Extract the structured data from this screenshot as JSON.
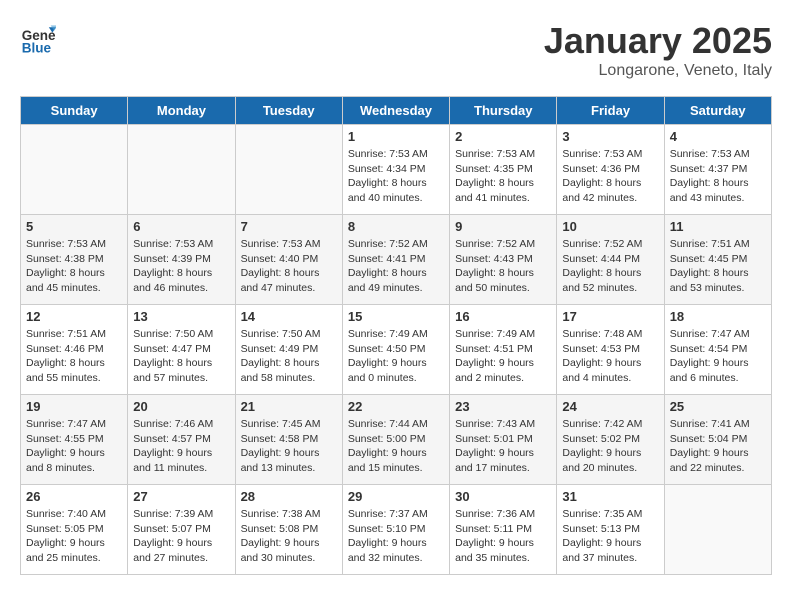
{
  "header": {
    "logo_general": "General",
    "logo_blue": "Blue",
    "month": "January 2025",
    "location": "Longarone, Veneto, Italy"
  },
  "weekdays": [
    "Sunday",
    "Monday",
    "Tuesday",
    "Wednesday",
    "Thursday",
    "Friday",
    "Saturday"
  ],
  "weeks": [
    [
      {
        "day": "",
        "sunrise": "",
        "sunset": "",
        "daylight": ""
      },
      {
        "day": "",
        "sunrise": "",
        "sunset": "",
        "daylight": ""
      },
      {
        "day": "",
        "sunrise": "",
        "sunset": "",
        "daylight": ""
      },
      {
        "day": "1",
        "sunrise": "Sunrise: 7:53 AM",
        "sunset": "Sunset: 4:34 PM",
        "daylight": "Daylight: 8 hours and 40 minutes."
      },
      {
        "day": "2",
        "sunrise": "Sunrise: 7:53 AM",
        "sunset": "Sunset: 4:35 PM",
        "daylight": "Daylight: 8 hours and 41 minutes."
      },
      {
        "day": "3",
        "sunrise": "Sunrise: 7:53 AM",
        "sunset": "Sunset: 4:36 PM",
        "daylight": "Daylight: 8 hours and 42 minutes."
      },
      {
        "day": "4",
        "sunrise": "Sunrise: 7:53 AM",
        "sunset": "Sunset: 4:37 PM",
        "daylight": "Daylight: 8 hours and 43 minutes."
      }
    ],
    [
      {
        "day": "5",
        "sunrise": "Sunrise: 7:53 AM",
        "sunset": "Sunset: 4:38 PM",
        "daylight": "Daylight: 8 hours and 45 minutes."
      },
      {
        "day": "6",
        "sunrise": "Sunrise: 7:53 AM",
        "sunset": "Sunset: 4:39 PM",
        "daylight": "Daylight: 8 hours and 46 minutes."
      },
      {
        "day": "7",
        "sunrise": "Sunrise: 7:53 AM",
        "sunset": "Sunset: 4:40 PM",
        "daylight": "Daylight: 8 hours and 47 minutes."
      },
      {
        "day": "8",
        "sunrise": "Sunrise: 7:52 AM",
        "sunset": "Sunset: 4:41 PM",
        "daylight": "Daylight: 8 hours and 49 minutes."
      },
      {
        "day": "9",
        "sunrise": "Sunrise: 7:52 AM",
        "sunset": "Sunset: 4:43 PM",
        "daylight": "Daylight: 8 hours and 50 minutes."
      },
      {
        "day": "10",
        "sunrise": "Sunrise: 7:52 AM",
        "sunset": "Sunset: 4:44 PM",
        "daylight": "Daylight: 8 hours and 52 minutes."
      },
      {
        "day": "11",
        "sunrise": "Sunrise: 7:51 AM",
        "sunset": "Sunset: 4:45 PM",
        "daylight": "Daylight: 8 hours and 53 minutes."
      }
    ],
    [
      {
        "day": "12",
        "sunrise": "Sunrise: 7:51 AM",
        "sunset": "Sunset: 4:46 PM",
        "daylight": "Daylight: 8 hours and 55 minutes."
      },
      {
        "day": "13",
        "sunrise": "Sunrise: 7:50 AM",
        "sunset": "Sunset: 4:47 PM",
        "daylight": "Daylight: 8 hours and 57 minutes."
      },
      {
        "day": "14",
        "sunrise": "Sunrise: 7:50 AM",
        "sunset": "Sunset: 4:49 PM",
        "daylight": "Daylight: 8 hours and 58 minutes."
      },
      {
        "day": "15",
        "sunrise": "Sunrise: 7:49 AM",
        "sunset": "Sunset: 4:50 PM",
        "daylight": "Daylight: 9 hours and 0 minutes."
      },
      {
        "day": "16",
        "sunrise": "Sunrise: 7:49 AM",
        "sunset": "Sunset: 4:51 PM",
        "daylight": "Daylight: 9 hours and 2 minutes."
      },
      {
        "day": "17",
        "sunrise": "Sunrise: 7:48 AM",
        "sunset": "Sunset: 4:53 PM",
        "daylight": "Daylight: 9 hours and 4 minutes."
      },
      {
        "day": "18",
        "sunrise": "Sunrise: 7:47 AM",
        "sunset": "Sunset: 4:54 PM",
        "daylight": "Daylight: 9 hours and 6 minutes."
      }
    ],
    [
      {
        "day": "19",
        "sunrise": "Sunrise: 7:47 AM",
        "sunset": "Sunset: 4:55 PM",
        "daylight": "Daylight: 9 hours and 8 minutes."
      },
      {
        "day": "20",
        "sunrise": "Sunrise: 7:46 AM",
        "sunset": "Sunset: 4:57 PM",
        "daylight": "Daylight: 9 hours and 11 minutes."
      },
      {
        "day": "21",
        "sunrise": "Sunrise: 7:45 AM",
        "sunset": "Sunset: 4:58 PM",
        "daylight": "Daylight: 9 hours and 13 minutes."
      },
      {
        "day": "22",
        "sunrise": "Sunrise: 7:44 AM",
        "sunset": "Sunset: 5:00 PM",
        "daylight": "Daylight: 9 hours and 15 minutes."
      },
      {
        "day": "23",
        "sunrise": "Sunrise: 7:43 AM",
        "sunset": "Sunset: 5:01 PM",
        "daylight": "Daylight: 9 hours and 17 minutes."
      },
      {
        "day": "24",
        "sunrise": "Sunrise: 7:42 AM",
        "sunset": "Sunset: 5:02 PM",
        "daylight": "Daylight: 9 hours and 20 minutes."
      },
      {
        "day": "25",
        "sunrise": "Sunrise: 7:41 AM",
        "sunset": "Sunset: 5:04 PM",
        "daylight": "Daylight: 9 hours and 22 minutes."
      }
    ],
    [
      {
        "day": "26",
        "sunrise": "Sunrise: 7:40 AM",
        "sunset": "Sunset: 5:05 PM",
        "daylight": "Daylight: 9 hours and 25 minutes."
      },
      {
        "day": "27",
        "sunrise": "Sunrise: 7:39 AM",
        "sunset": "Sunset: 5:07 PM",
        "daylight": "Daylight: 9 hours and 27 minutes."
      },
      {
        "day": "28",
        "sunrise": "Sunrise: 7:38 AM",
        "sunset": "Sunset: 5:08 PM",
        "daylight": "Daylight: 9 hours and 30 minutes."
      },
      {
        "day": "29",
        "sunrise": "Sunrise: 7:37 AM",
        "sunset": "Sunset: 5:10 PM",
        "daylight": "Daylight: 9 hours and 32 minutes."
      },
      {
        "day": "30",
        "sunrise": "Sunrise: 7:36 AM",
        "sunset": "Sunset: 5:11 PM",
        "daylight": "Daylight: 9 hours and 35 minutes."
      },
      {
        "day": "31",
        "sunrise": "Sunrise: 7:35 AM",
        "sunset": "Sunset: 5:13 PM",
        "daylight": "Daylight: 9 hours and 37 minutes."
      },
      {
        "day": "",
        "sunrise": "",
        "sunset": "",
        "daylight": ""
      }
    ]
  ]
}
